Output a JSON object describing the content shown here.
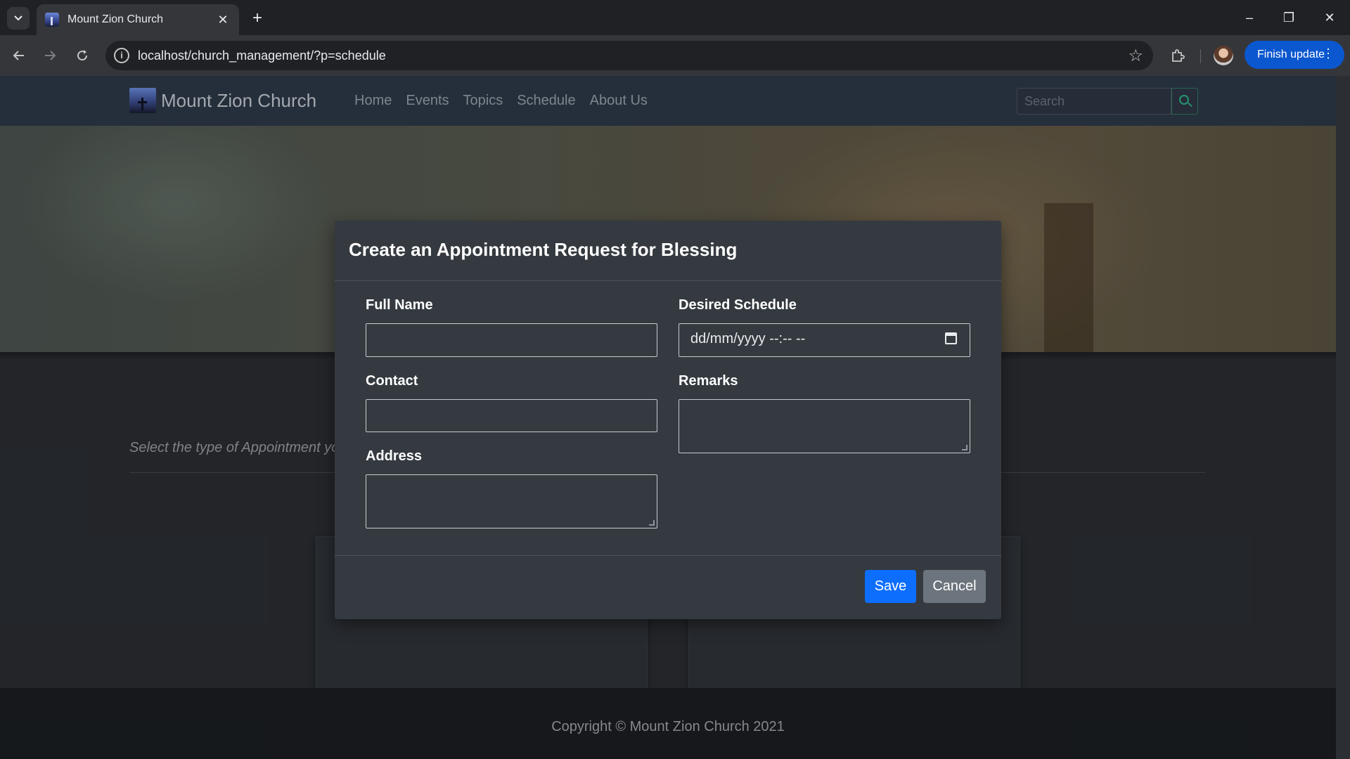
{
  "browser": {
    "tab_title": "Mount Zion Church",
    "tab_close": "✕",
    "new_tab": "+",
    "url": "localhost/church_management/?p=schedule",
    "finish_update_label": "Finish update",
    "window_controls": {
      "minimize": "–",
      "restore": "❐",
      "close": "✕"
    },
    "icons": {
      "back": "back-arrow-icon",
      "forward": "forward-arrow-icon",
      "reload": "reload-icon",
      "info": "info-icon",
      "bookmark": "star-icon",
      "extensions": "puzzle-icon",
      "menu": "kebab-menu-icon"
    }
  },
  "site": {
    "brand": "Mount Zion Church",
    "nav": [
      "Home",
      "Events",
      "Topics",
      "Schedule",
      "About Us"
    ],
    "search_placeholder": "Search",
    "section_subtitle": "Select the type of Appointment yo",
    "footer": "Copyright © Mount Zion Church 2021"
  },
  "modal": {
    "title": "Create an Appointment Request for Blessing",
    "fields": {
      "full_name": {
        "label": "Full Name",
        "value": ""
      },
      "contact": {
        "label": "Contact",
        "value": ""
      },
      "address": {
        "label": "Address",
        "value": ""
      },
      "desired_schedule": {
        "label": "Desired Schedule",
        "placeholder": "dd/mm/yyyy --:-- --"
      },
      "remarks": {
        "label": "Remarks",
        "value": ""
      }
    },
    "buttons": {
      "save": "Save",
      "cancel": "Cancel"
    }
  },
  "colors": {
    "primary": "#0d6efd",
    "secondary": "#6c757d",
    "modal_bg": "#343a40",
    "navbar_bg": "#2e3a49",
    "chrome_update": "#0b57d0"
  }
}
